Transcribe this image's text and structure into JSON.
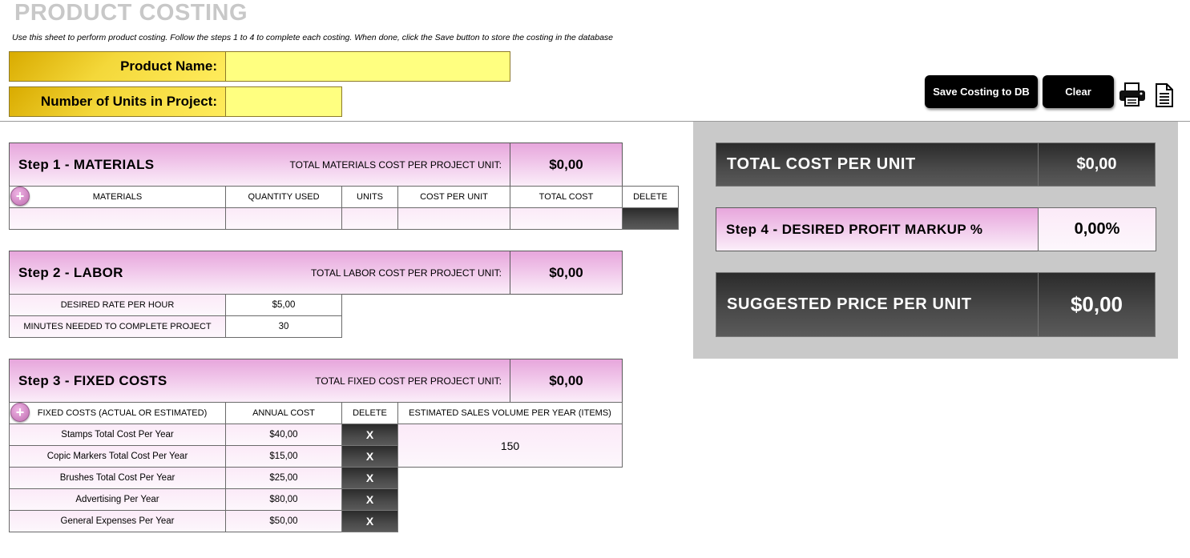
{
  "header": {
    "title": "PRODUCT COSTING",
    "subtitle": "Use this sheet to perform product costing. Follow the steps 1 to 4 to complete each costing. When done, click the Save button to store the costing in the database"
  },
  "inputs": {
    "product_name_label": "Product Name:",
    "product_name_value": "",
    "units_label": "Number of Units in Project:",
    "units_value": ""
  },
  "toolbar": {
    "save_label": "Save Costing to DB",
    "clear_label": "Clear",
    "print_icon": "printer-icon",
    "document_icon": "document-icon"
  },
  "step1": {
    "title": "Step 1 - MATERIALS",
    "total_label": "TOTAL MATERIALS COST PER PROJECT UNIT:",
    "total_value": "$0,00",
    "columns": [
      "MATERIALS",
      "QUANTITY USED",
      "UNITS",
      "COST PER UNIT",
      "TOTAL COST",
      "DELETE"
    ],
    "rows": [
      [
        "",
        "",
        "",
        "",
        "",
        ""
      ]
    ]
  },
  "step2": {
    "title": "Step 2 - LABOR",
    "total_label": "TOTAL LABOR COST PER PROJECT UNIT:",
    "total_value": "$0,00",
    "rate_label": "DESIRED RATE PER HOUR",
    "rate_value": "$5,00",
    "minutes_label": "MINUTES NEEDED TO COMPLETE PROJECT",
    "minutes_value": "30"
  },
  "step3": {
    "title": "Step 3 - FIXED COSTS",
    "total_label": "TOTAL FIXED COST PER PROJECT UNIT:",
    "total_value": "$0,00",
    "columns": [
      "FIXED COSTS (ACTUAL OR ESTIMATED)",
      "ANNUAL COST",
      "DELETE",
      "ESTIMATED SALES VOLUME PER YEAR (ITEMS)"
    ],
    "sales_volume": "150",
    "delete_glyph": "X",
    "rows": [
      {
        "name": "Stamps Total Cost Per Year",
        "cost": "$40,00"
      },
      {
        "name": "Copic Markers Total Cost Per Year",
        "cost": "$15,00"
      },
      {
        "name": "Brushes Total Cost Per Year",
        "cost": "$25,00"
      },
      {
        "name": "Advertising Per Year",
        "cost": "$80,00"
      },
      {
        "name": "General Expenses Per Year",
        "cost": "$50,00"
      }
    ]
  },
  "summary": {
    "total_cost_label": "TOTAL COST PER UNIT",
    "total_cost_value": "$0,00",
    "markup_label": "Step 4 - DESIRED PROFIT MARKUP %",
    "markup_value": "0,00%",
    "price_label": "SUGGESTED PRICE PER UNIT",
    "price_value": "$0,00"
  },
  "colors": {
    "accent_pink": "#e7a6dc",
    "gold": "#f4d83a",
    "input_yellow": "#ffff80",
    "dark_panel": "#3a3a3a",
    "title_grey": "#c8c8c8"
  }
}
